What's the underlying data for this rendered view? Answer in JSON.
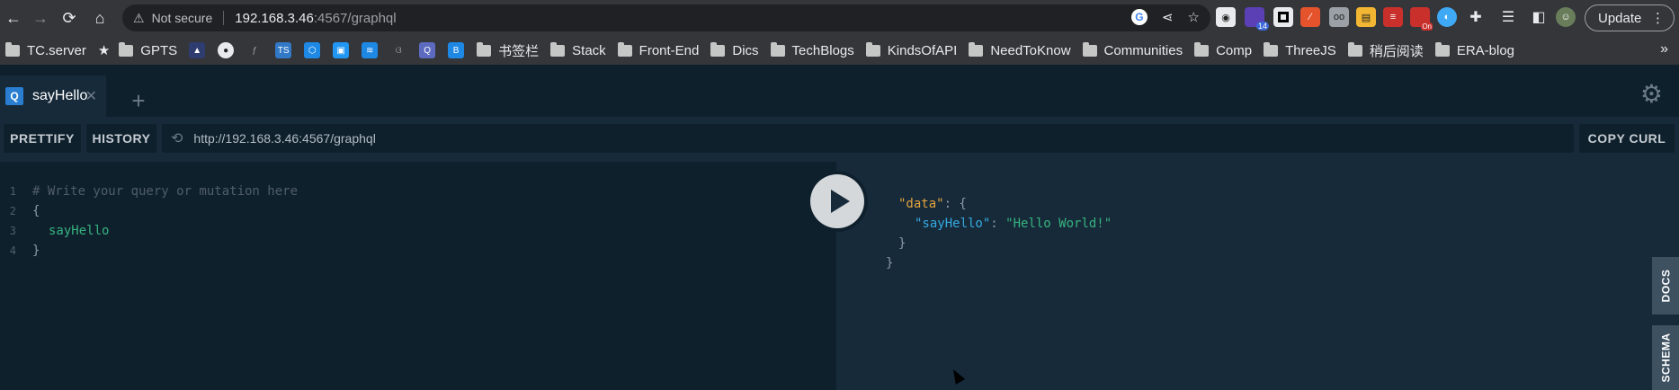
{
  "browser": {
    "nav": {
      "back": "←",
      "forward": "→",
      "reload": "⟳",
      "home": "⌂"
    },
    "address": {
      "security_label": "Not secure",
      "host": "192.168.3.46",
      "path": ":4567/graphql"
    },
    "update_label": "Update",
    "bookmarks": [
      {
        "type": "text",
        "label": "TC.server"
      },
      {
        "type": "star-folder",
        "label": "GPTS"
      },
      {
        "type": "folder",
        "label": "书签栏"
      },
      {
        "type": "folder",
        "label": "Stack"
      },
      {
        "type": "folder",
        "label": "Front-End"
      },
      {
        "type": "folder",
        "label": "Dics"
      },
      {
        "type": "folder",
        "label": "TechBlogs"
      },
      {
        "type": "folder",
        "label": "KindsOfAPI"
      },
      {
        "type": "folder",
        "label": "NeedToKnow"
      },
      {
        "type": "folder",
        "label": "Communities"
      },
      {
        "type": "folder",
        "label": "Comp"
      },
      {
        "type": "folder",
        "label": "ThreeJS"
      },
      {
        "type": "folder",
        "label": "稍后阅读"
      },
      {
        "type": "folder",
        "label": "ERA-blog"
      }
    ],
    "extension_badge": "14",
    "extension_on_badge": "On"
  },
  "playground": {
    "tab": {
      "badge": "Q",
      "title": "sayHello",
      "close": "✕"
    },
    "add_tab": "+",
    "prettify_label": "PRETTIFY",
    "history_label": "HISTORY",
    "endpoint_url": "http://192.168.3.46:4567/graphql",
    "copy_curl_label": "COPY CURL",
    "editor": {
      "lines": [
        {
          "n": "1",
          "text": "# Write your query or mutation here"
        },
        {
          "n": "2",
          "text": "{"
        },
        {
          "n": "3",
          "text": "sayHello"
        },
        {
          "n": "4",
          "text": "}"
        }
      ]
    },
    "result": {
      "open": "{",
      "data_key": "\"data\"",
      "colon": ": {",
      "say_key": "\"sayHello\"",
      "say_colon": ": ",
      "say_value": "\"Hello World!\"",
      "inner_close": "}",
      "outer_close": "}"
    },
    "docs_label": "DOCS",
    "schema_label": "SCHEMA"
  }
}
